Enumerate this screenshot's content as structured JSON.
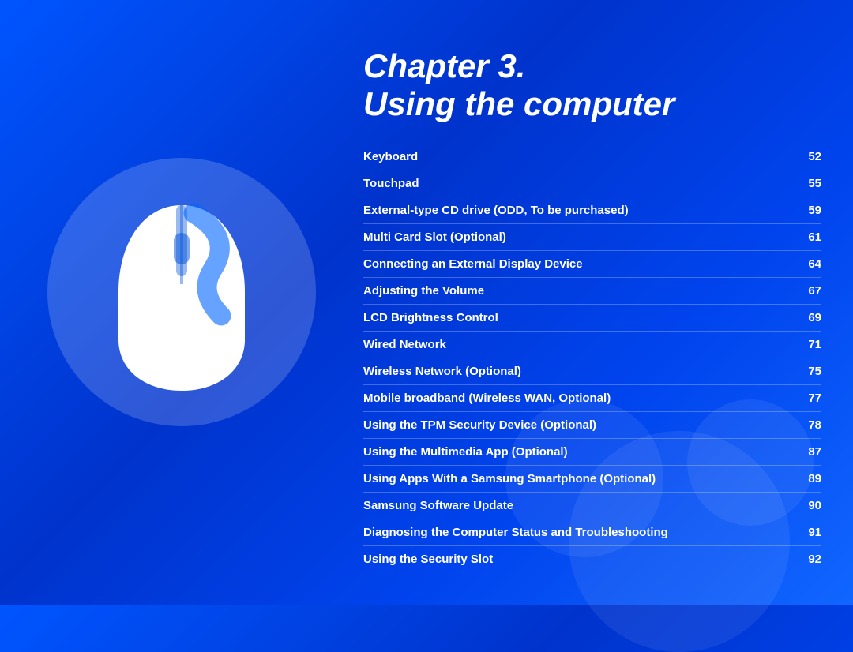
{
  "background": {
    "color_start": "#0055ff",
    "color_end": "#0033cc"
  },
  "chapter": {
    "number_label": "Chapter 3.",
    "title": "Using the computer"
  },
  "toc": {
    "items": [
      {
        "label": "Keyboard",
        "page": "52"
      },
      {
        "label": "Touchpad",
        "page": "55"
      },
      {
        "label": "External-type CD drive (ODD, To be purchased)",
        "page": "59"
      },
      {
        "label": "Multi Card Slot (Optional)",
        "page": "61"
      },
      {
        "label": "Connecting an External Display Device",
        "page": "64"
      },
      {
        "label": "Adjusting the Volume",
        "page": "67"
      },
      {
        "label": "LCD Brightness Control",
        "page": "69"
      },
      {
        "label": "Wired Network",
        "page": "71"
      },
      {
        "label": "Wireless Network (Optional)",
        "page": "75"
      },
      {
        "label": "Mobile broadband (Wireless WAN, Optional)",
        "page": "77"
      },
      {
        "label": "Using the TPM Security Device (Optional)",
        "page": "78"
      },
      {
        "label": "Using the Multimedia App (Optional)",
        "page": "87"
      },
      {
        "label": "Using Apps With a Samsung Smartphone (Optional)",
        "page": "89"
      },
      {
        "label": "Samsung Software Update",
        "page": "90"
      },
      {
        "label": "Diagnosing the Computer Status and Troubleshooting",
        "page": "91"
      },
      {
        "label": "Using the Security Slot",
        "page": "92"
      }
    ]
  },
  "mouse_icon": {
    "alt": "Computer mouse illustration"
  }
}
